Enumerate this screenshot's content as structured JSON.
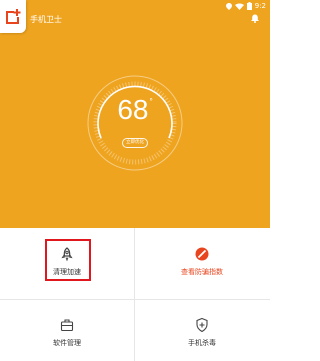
{
  "status_bar": {
    "time": "9:2"
  },
  "app": {
    "title": "手机卫士"
  },
  "score": {
    "value": "68",
    "unit": "°",
    "check_label": "立即优化"
  },
  "tiles": [
    {
      "label": "清理加速",
      "icon": "rocket-icon",
      "color": "#333333"
    },
    {
      "label": "查看防骗指数",
      "icon": "no-entry-icon",
      "color": "#E8451E"
    },
    {
      "label": "软件管理",
      "icon": "briefcase-icon",
      "color": "#333333"
    },
    {
      "label": "手机杀毒",
      "icon": "shield-icon",
      "color": "#333333"
    }
  ],
  "colors": {
    "header": "#EFA41F",
    "badge_icon": "#E8451E",
    "highlight": "#E0171F"
  }
}
